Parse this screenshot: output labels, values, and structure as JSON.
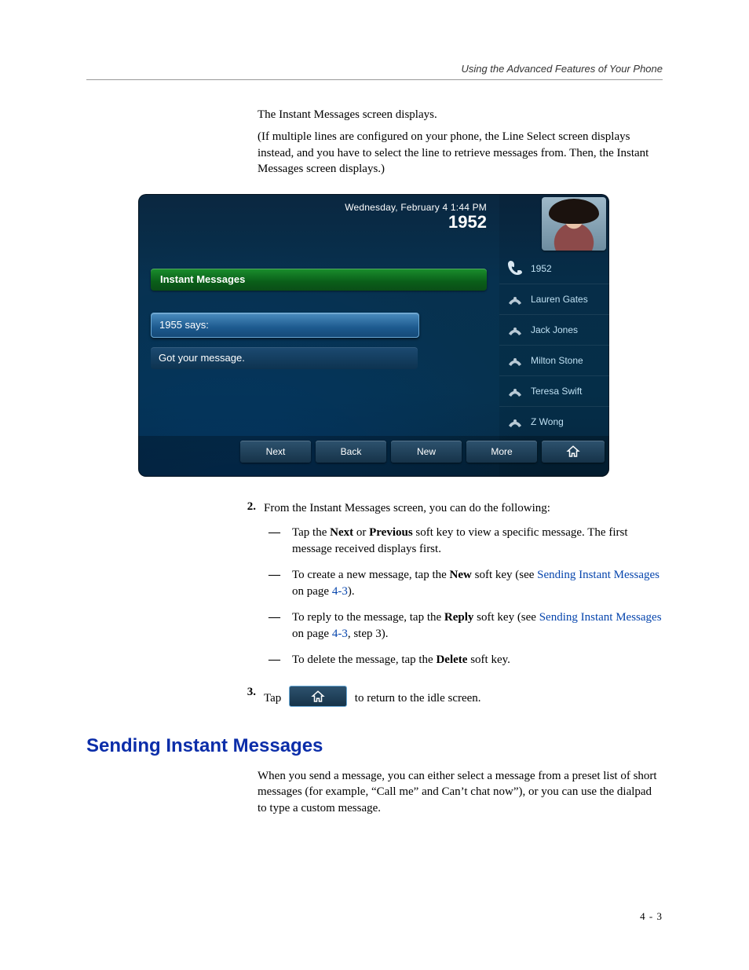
{
  "running_head": "Using the Advanced Features of Your Phone",
  "intro": {
    "p1": "The Instant Messages screen displays.",
    "p2": "(If multiple lines are configured on your phone, the Line Select screen displays instead, and you have to select the line to retrieve messages from. Then, the Instant Messages screen displays.)"
  },
  "screenshot": {
    "datetime": "Wednesday, February 4  1:44 PM",
    "extension": "1952",
    "im_header": "Instant Messages",
    "from_label": "1955 says:",
    "message_body": "Got your message.",
    "contacts": [
      {
        "label": "1952"
      },
      {
        "label": "Lauren Gates"
      },
      {
        "label": "Jack Jones"
      },
      {
        "label": "Milton Stone"
      },
      {
        "label": "Teresa Swift"
      },
      {
        "label": "Z Wong"
      }
    ],
    "softkeys": {
      "next": "Next",
      "back": "Back",
      "new": "New",
      "more": "More"
    }
  },
  "steps": {
    "step2_num": "2.",
    "step2_intro": "From the Instant Messages screen, you can do the following:",
    "bullet1a": "Tap the ",
    "bullet1_next": "Next",
    "bullet1_or": " or ",
    "bullet1_prev": "Previous",
    "bullet1b": " soft key to view a specific message. The first message received displays first.",
    "bullet2a": "To create a new message, tap the ",
    "bullet2_new": "New",
    "bullet2b": " soft key (see ",
    "bullet2_link": "Sending Instant Messages",
    "bullet2_on": " on page ",
    "bullet2_page": "4-3",
    "bullet2c": ").",
    "bullet3a": "To reply to the message, tap the ",
    "bullet3_reply": "Reply",
    "bullet3b": " soft key (see ",
    "bullet3_link": "Sending Instant Messages",
    "bullet3_on": " on page ",
    "bullet3_page": "4-3",
    "bullet3c": ", step 3).",
    "bullet4a": "To delete the message, tap the ",
    "bullet4_del": "Delete",
    "bullet4b": " soft key.",
    "step3_num": "3.",
    "step3a": "Tap ",
    "step3b": " to return to the idle screen."
  },
  "section_heading": "Sending Instant Messages",
  "section_para": "When you send a message, you can either select a message from a preset list of short messages (for example, “Call me” and Can’t chat now”), or you can use the dialpad to type a custom message.",
  "page_number": "4 - 3"
}
